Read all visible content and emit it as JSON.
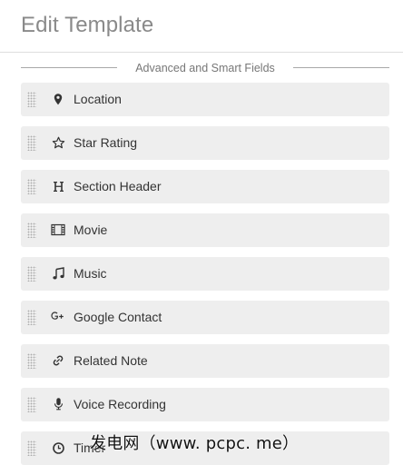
{
  "header": {
    "title": "Edit Template"
  },
  "section": {
    "label": "Advanced and Smart Fields"
  },
  "fields": [
    {
      "label": "Location",
      "icon": "location-pin-icon"
    },
    {
      "label": "Star Rating",
      "icon": "star-icon"
    },
    {
      "label": "Section Header",
      "icon": "heading-icon"
    },
    {
      "label": "Movie",
      "icon": "film-icon"
    },
    {
      "label": "Music",
      "icon": "music-note-icon"
    },
    {
      "label": "Google Contact",
      "icon": "google-plus-icon"
    },
    {
      "label": "Related Note",
      "icon": "link-icon"
    },
    {
      "label": "Voice Recording",
      "icon": "microphone-icon"
    },
    {
      "label": "Timer",
      "icon": "clock-icon"
    }
  ],
  "watermark": {
    "text": "发电网（www. pcpc. me）"
  },
  "colors": {
    "title": "#8a8a8a",
    "row_background": "#eeeeee",
    "text": "#333333",
    "divider": "#a8a8a8"
  }
}
